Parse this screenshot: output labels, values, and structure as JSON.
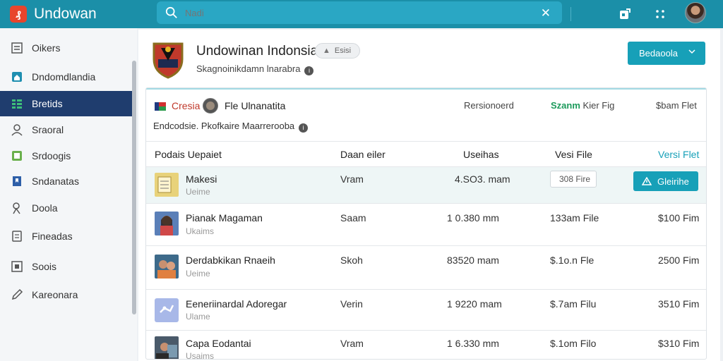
{
  "app": {
    "name": "Undowan",
    "logo_glyph": "₰"
  },
  "search": {
    "placeholder": "Nadi"
  },
  "sidebar": {
    "items": [
      {
        "label": "Oikers",
        "icon": "list-icon"
      },
      {
        "label": "Dndomdlandia",
        "icon": "home-icon"
      },
      {
        "label": "Bretids",
        "icon": "grid-icon",
        "active": true
      },
      {
        "label": "Sraoral",
        "icon": "user-icon"
      },
      {
        "label": "Srdoogis",
        "icon": "box-icon"
      },
      {
        "label": "Sndanatas",
        "icon": "bookmark-icon"
      },
      {
        "label": "Doola",
        "icon": "person-icon"
      },
      {
        "label": "Fineadas",
        "icon": "document-icon"
      },
      {
        "label": "Soois",
        "icon": "square-icon"
      },
      {
        "label": "Kareonara",
        "icon": "pen-icon"
      }
    ]
  },
  "header": {
    "title": "Undowinan Indonsia",
    "badge": "Esisi",
    "subtitle": "Skagnoinikdamn lnarabra",
    "primary_button": "Bedaoola"
  },
  "summary": {
    "name": "Cresia",
    "file": "Fle Ulnanatita",
    "subtitle": "Endcodsie. Pkofkaire Maarrerooba",
    "col1": "Rersionoerd",
    "col2_strong": "Szanm",
    "col2_rest": "Kier Fig",
    "col3": "$bam Flet"
  },
  "table": {
    "headers": [
      "Podais Uepaiet",
      "Daan eiler",
      "Useihas",
      "Vesi File",
      "Versi Flet"
    ],
    "rows": [
      {
        "title": "Makesi",
        "sub": "Ueime",
        "col2": "Vram",
        "col3": "4.SO3. mam",
        "chip": "308 Fire",
        "action": "Gleirihe",
        "selected": true
      },
      {
        "title": "Pianak Magaman",
        "sub": "Ukaims",
        "col2": "Saam",
        "col3": "1 0.380 mm",
        "col4": "133am File",
        "col5": "$100 Fim"
      },
      {
        "title": "Derdabkikan Rnaeih",
        "sub": "Ueime",
        "col2": "Skoh",
        "col3": "83520 mam",
        "col4": "$.1o.n Fle",
        "col5": "2500 Fim"
      },
      {
        "title": "Eeneriinardal Adoregar",
        "sub": "Ulame",
        "col2": "Verin",
        "col3": "1 9220 mam",
        "col4": "$.7am Filu",
        "col5": "3510 Fim"
      },
      {
        "title": "Capa Eodantai",
        "sub": "Usaims",
        "col2": "Vram",
        "col3": "1 6.330 mm",
        "col4": "$.1om Filo",
        "col5": "$310 Fim"
      }
    ]
  }
}
